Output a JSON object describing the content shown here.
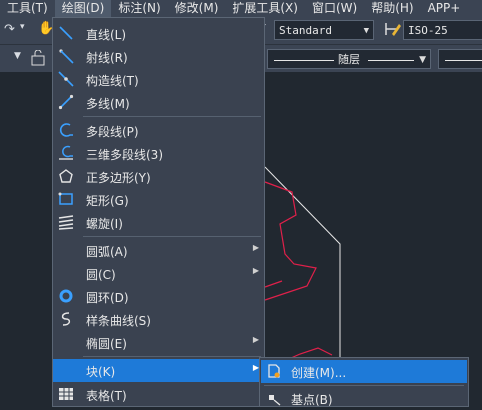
{
  "menubar": {
    "items": [
      "工具(T)",
      "绘图(D)",
      "标注(N)",
      "修改(M)",
      "扩展工具(X)",
      "窗口(W)",
      "帮助(H)",
      "APP+"
    ]
  },
  "toolbar": {
    "text_style": "Standard",
    "dim_style": "ISO-25",
    "layer_linetype": "随层"
  },
  "draw_menu": {
    "items": [
      {
        "label": "直线(L)",
        "icon": "line-icon"
      },
      {
        "label": "射线(R)",
        "icon": "ray-icon"
      },
      {
        "label": "构造线(T)",
        "icon": "construction-line-icon"
      },
      {
        "label": "多线(M)",
        "icon": "multiline-icon"
      },
      {
        "label": "多段线(P)",
        "icon": "polyline-icon"
      },
      {
        "label": "三维多段线(3)",
        "icon": "3d-polyline-icon"
      },
      {
        "label": "正多边形(Y)",
        "icon": "polygon-icon"
      },
      {
        "label": "矩形(G)",
        "icon": "rectangle-icon"
      },
      {
        "label": "螺旋(I)",
        "icon": "helix-icon"
      },
      {
        "label": "圆弧(A)",
        "icon": ""
      },
      {
        "label": "圆(C)",
        "icon": ""
      },
      {
        "label": "圆环(D)",
        "icon": "donut-icon"
      },
      {
        "label": "样条曲线(S)",
        "icon": "spline-icon"
      },
      {
        "label": "椭圆(E)",
        "icon": ""
      },
      {
        "label": "块(K)",
        "icon": ""
      },
      {
        "label": "表格(T)",
        "icon": "table-icon"
      }
    ]
  },
  "block_submenu": {
    "items": [
      {
        "label": "创建(M)...",
        "icon": "create-block-icon"
      },
      {
        "label": "基点(B)",
        "icon": "base-point-icon"
      }
    ]
  },
  "colors": {
    "menu_bg": "#3a4250",
    "highlight": "#1e7ad8",
    "canvas_bg": "#212830",
    "geometry_red": "#e0204a"
  }
}
